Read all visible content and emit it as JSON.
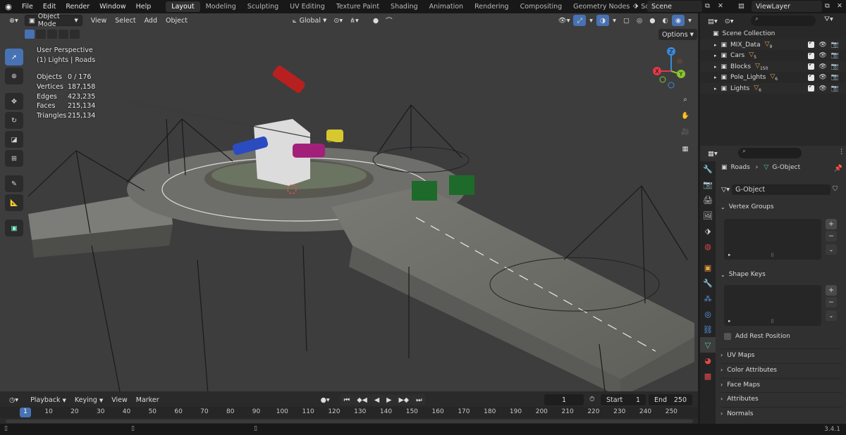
{
  "topbar": {
    "menus": [
      "File",
      "Edit",
      "Render",
      "Window",
      "Help"
    ],
    "workspaces": [
      "Layout",
      "Modeling",
      "Sculpting",
      "UV Editing",
      "Texture Paint",
      "Shading",
      "Animation",
      "Rendering",
      "Compositing",
      "Geometry Nodes",
      "Scripting"
    ],
    "active_workspace": "Layout",
    "add_tab": "+",
    "scene": "Scene",
    "view_layer": "ViewLayer"
  },
  "viewport": {
    "mode": "Object Mode",
    "menus": [
      "View",
      "Select",
      "Add",
      "Object"
    ],
    "transform_orientation": "Global",
    "options_label": "Options",
    "perspective": "User Perspective",
    "collection_info": "(1) Lights | Roads",
    "stats": [
      {
        "label": "Objects",
        "value": "0 / 176"
      },
      {
        "label": "Vertices",
        "value": "187,158"
      },
      {
        "label": "Edges",
        "value": "423,235"
      },
      {
        "label": "Faces",
        "value": "215,134"
      },
      {
        "label": "Triangles",
        "value": "215,134"
      }
    ],
    "gizmo": {
      "x": "X",
      "y": "Y",
      "z": "Z"
    }
  },
  "timeline": {
    "menus": [
      "Playback",
      "Keying",
      "View",
      "Marker"
    ],
    "current_frame": "1",
    "start_label": "Start",
    "start": "1",
    "end_label": "End",
    "end": "250",
    "ruler": [
      "1",
      "10",
      "20",
      "30",
      "40",
      "50",
      "60",
      "70",
      "80",
      "90",
      "100",
      "110",
      "120",
      "130",
      "140",
      "150",
      "160",
      "170",
      "180",
      "190",
      "200",
      "210",
      "220",
      "230",
      "240",
      "250"
    ]
  },
  "outliner": {
    "root": "Scene Collection",
    "items": [
      {
        "name": "MIX_Data",
        "badge": "9"
      },
      {
        "name": "Cars",
        "badge": "5"
      },
      {
        "name": "Blocks",
        "badge": "150"
      },
      {
        "name": "Pole_Lights",
        "badge": "6"
      },
      {
        "name": "Lights",
        "badge": "6"
      }
    ]
  },
  "properties": {
    "breadcrumb_object": "Roads",
    "breadcrumb_data": "G-Object",
    "data_name": "G-Object",
    "panels": {
      "vertex_groups": "Vertex Groups",
      "shape_keys": "Shape Keys",
      "add_rest_position": "Add Rest Position",
      "uv_maps": "UV Maps",
      "color_attributes": "Color Attributes",
      "face_maps": "Face Maps",
      "attributes": "Attributes",
      "normals": "Normals"
    }
  },
  "status": {
    "version": "3.4.1"
  },
  "colors": {
    "accent": "#4772b3",
    "active_frame": "#4772b3",
    "x_axis": "#e3384b",
    "y_axis": "#8ac52e",
    "z_axis": "#3b8ad8"
  }
}
